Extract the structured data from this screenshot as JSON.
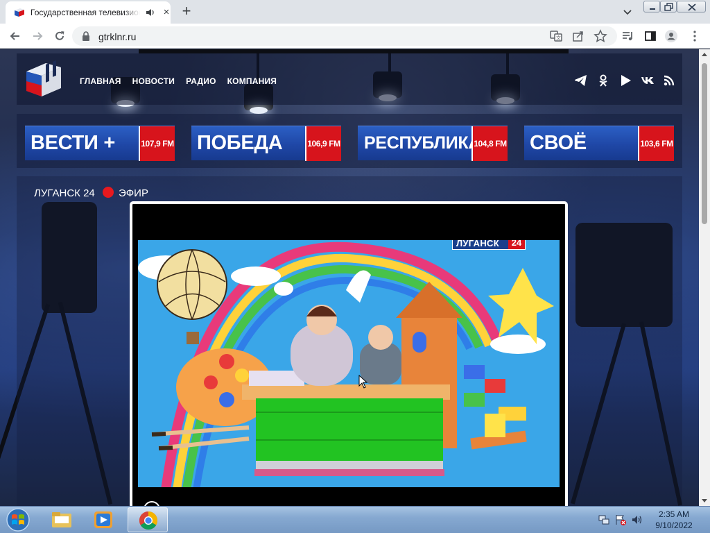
{
  "browser": {
    "tab_title": "Государственная телевизионная и радиовещательная компания ЛНР",
    "tab_close_symbol": "×",
    "new_tab_symbol": "+",
    "url": "gtrklnr.ru"
  },
  "site": {
    "nav": [
      "ГЛАВНАЯ",
      "НОВОСТИ",
      "РАДИО",
      "КОМПАНИЯ"
    ],
    "social_icons": [
      "telegram-icon",
      "odnoklassniki-icon",
      "youtube-icon",
      "vk-icon",
      "rss-icon"
    ],
    "stations": [
      {
        "name": "ВЕСТИ +",
        "freq": "107,9 FM"
      },
      {
        "name": "ПОБЕДА",
        "freq": "106,9 FM"
      },
      {
        "name": "РЕСПУБЛИКА",
        "freq": "104,8 FM"
      },
      {
        "name": "СВОЁ",
        "freq": "103,6 FM"
      }
    ],
    "live": {
      "channel": "ЛУГАНСК 24",
      "efir": "ЭФИР"
    },
    "video_badge": {
      "name": "ЛУГАНСК",
      "number": "24"
    }
  },
  "colors": {
    "accent_red": "#d7141c",
    "station_blue": "#1f47a6"
  },
  "taskbar": {
    "apps": [
      "windows-explorer",
      "windows-media-player",
      "google-chrome"
    ],
    "time": "2:35 AM",
    "date": "9/10/2022"
  }
}
